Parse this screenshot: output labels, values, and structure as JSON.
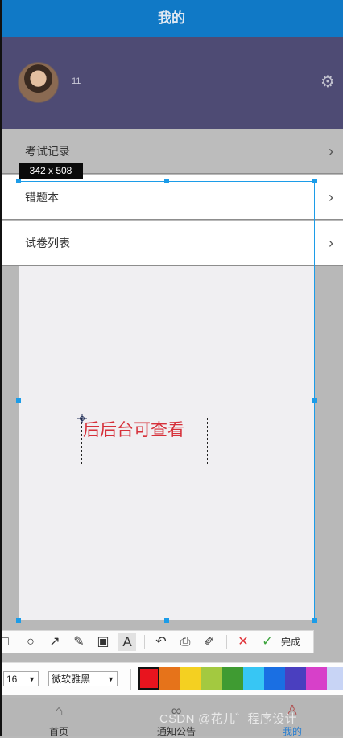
{
  "header": {
    "title": "我的"
  },
  "profile": {
    "username": "11"
  },
  "menu": [
    {
      "label": "考试记录"
    },
    {
      "label": "错题本"
    },
    {
      "label": "试卷列表"
    }
  ],
  "screenshot_tool": {
    "size_badge": "342 x 508",
    "annotation_text": "后后台可查看",
    "annotation_color": "#d6303a",
    "toolbar": {
      "done_label": "完成"
    },
    "font_size_value": "16",
    "font_family_value": "微软雅黑",
    "palette": [
      "#e8141e",
      "#e6731a",
      "#f4d021",
      "#a3c940",
      "#3f9b32",
      "#37c6f4",
      "#1a6fe3",
      "#4a3fbf",
      "#d740c9",
      "#c8d4f5"
    ]
  },
  "tabbar": {
    "items": [
      {
        "label": "首页",
        "icon": "home-icon"
      },
      {
        "label": "通知公告",
        "icon": "bubbles-icon"
      },
      {
        "label": "我的",
        "icon": "user-icon"
      }
    ]
  },
  "watermark": "CSDN @花儿゛程序设计",
  "colors": {
    "header": "#1079c6",
    "profile": "#4e4b74",
    "selection": "#1c9ce8"
  }
}
